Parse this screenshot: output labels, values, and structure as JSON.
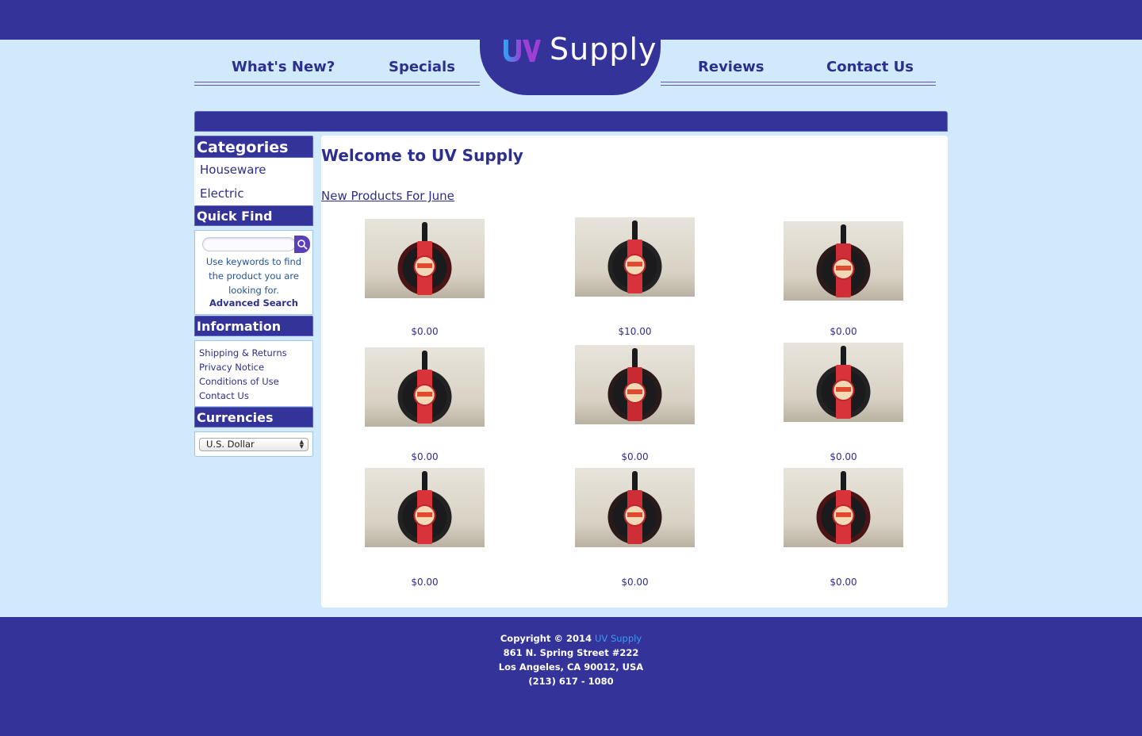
{
  "header": {
    "brand_name": "Supply",
    "brand_mark": "UV",
    "nav": [
      "What's New?",
      "Specials",
      "Reviews",
      "Contact Us"
    ]
  },
  "sidebar": {
    "categories_title": "Categories",
    "categories": [
      "Houseware",
      "Electric"
    ],
    "quick_find_title": "Quick Find",
    "search_placeholder": "",
    "search_help": "Use keywords to find the product you are looking for.",
    "advanced_search": "Advanced Search",
    "information_title": "Information",
    "information_links": [
      "Shipping & Returns",
      "Privacy Notice",
      "Conditions of Use",
      "Contact Us"
    ],
    "currencies_title": "Currencies",
    "currency_selected": "U.S. Dollar"
  },
  "main": {
    "title": "Welcome to UV Supply",
    "subtitle": "New Products For June",
    "products": [
      {
        "price": "$0.00"
      },
      {
        "price": "$10.00"
      },
      {
        "price": "$0.00"
      },
      {
        "price": "$0.00"
      },
      {
        "price": "$0.00"
      },
      {
        "price": "$0.00"
      },
      {
        "price": "$0.00"
      },
      {
        "price": "$0.00"
      },
      {
        "price": "$0.00"
      }
    ]
  },
  "footer": {
    "copyright_prefix": "Copyright © 2014",
    "copyright_brand": "UV Supply",
    "address1": "861 N. Spring Street #222",
    "address2": "Los Angeles, CA 90012, USA",
    "phone": "(213) 617 - 1080"
  },
  "colors": {
    "brand_navy": "#34339a",
    "page_bg": "#d0eafc",
    "link_blue": "#2d2f8c",
    "footer_brand": "#3a9cf5"
  },
  "icons": [
    "search-icon",
    "uv-logo-icon",
    "frying-pan-image"
  ]
}
